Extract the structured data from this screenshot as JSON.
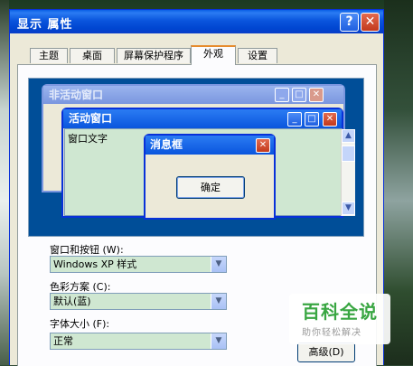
{
  "window": {
    "title": "显示 属性",
    "help": "?",
    "close": "✕"
  },
  "tabs": [
    "主题",
    "桌面",
    "屏幕保护程序",
    "外观",
    "设置"
  ],
  "preview": {
    "inactive_title": "非活动窗口",
    "active_title": "活动窗口",
    "window_text": "窗口文字",
    "msgbox_title": "消息框",
    "ok_label": "确定"
  },
  "form": {
    "windows_buttons_label": "窗口和按钮 (W):",
    "windows_buttons_value": "Windows XP 样式",
    "color_scheme_label": "色彩方案 (C):",
    "color_scheme_value": "默认(蓝)",
    "font_size_label": "字体大小 (F):",
    "font_size_value": "正常",
    "advanced_label": "高级(D)"
  },
  "watermark": {
    "brand": "百科全说",
    "sub": "助你轻松解决"
  },
  "icons": {
    "minimize": "_",
    "maximize": "□",
    "close": "✕",
    "dropdown": "▼",
    "scroll_up": "▲",
    "scroll_down": "▼"
  }
}
